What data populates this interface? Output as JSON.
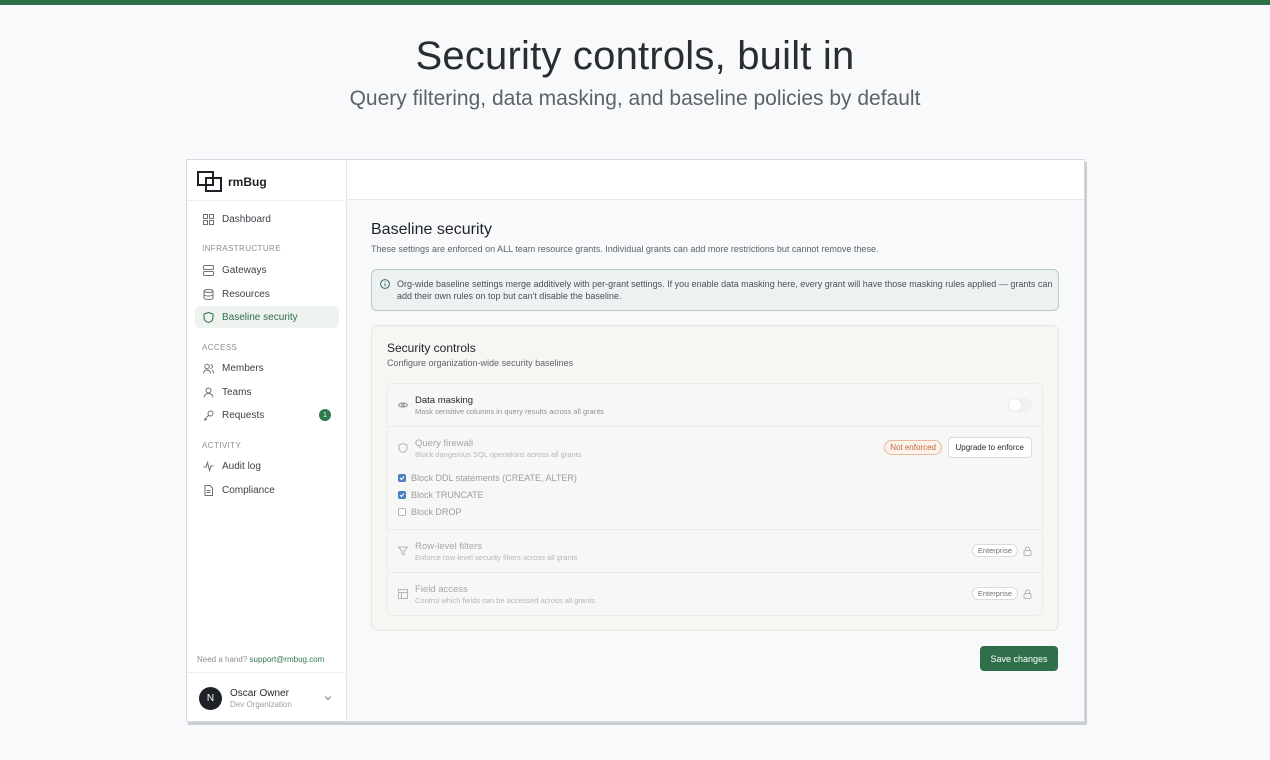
{
  "hero": {
    "title": "Security controls, built in",
    "subtitle": "Query filtering, data masking, and baseline policies by default"
  },
  "brand": {
    "name": "rmBug"
  },
  "sidebar": {
    "items": [
      {
        "label": "Dashboard",
        "icon": "grid-icon"
      },
      {
        "label": "Gateways",
        "icon": "server-icon"
      },
      {
        "label": "Resources",
        "icon": "database-icon"
      },
      {
        "label": "Baseline security",
        "icon": "shield-icon",
        "active": true
      },
      {
        "label": "Members",
        "icon": "users-icon"
      },
      {
        "label": "Teams",
        "icon": "team-icon"
      },
      {
        "label": "Requests",
        "icon": "key-icon",
        "badge": "1"
      },
      {
        "label": "Audit log",
        "icon": "activity-icon"
      },
      {
        "label": "Compliance",
        "icon": "document-icon"
      }
    ],
    "sections": {
      "infrastructure": "INFRASTRUCTURE",
      "access": "ACCESS",
      "activity": "ACTIVITY"
    },
    "help_text": "Need a hand?",
    "help_link": "support@rmbug.com",
    "user": {
      "initial": "N",
      "name": "Oscar Owner",
      "org": "Dev Organization"
    }
  },
  "main": {
    "title": "Baseline security",
    "description": "These settings are enforced on ALL team resource grants. Individual grants can add more restrictions but cannot remove these.",
    "info": "Org-wide baseline settings merge additively with per-grant settings. If you enable data masking here, every grant will have those masking rules applied — grants can add their own rules on top but can't disable the baseline.",
    "card": {
      "title": "Security controls",
      "subtitle": "Configure organization-wide security baselines",
      "data_masking": {
        "title": "Data masking",
        "subtitle": "Mask sensitive columns in query results across all grants",
        "enabled": false
      },
      "query_firewall": {
        "title": "Query firewall",
        "subtitle": "Block dangerous SQL operations across all grants",
        "status": "Not enforced",
        "button": "Upgrade to enforce",
        "options": [
          {
            "label": "Block DDL statements (CREATE, ALTER)",
            "checked": true
          },
          {
            "label": "Block TRUNCATE",
            "checked": true
          },
          {
            "label": "Block DROP",
            "checked": false
          }
        ]
      },
      "row_filters": {
        "title": "Row-level filters",
        "subtitle": "Enforce row-level security filters across all grants",
        "tier": "Enterprise"
      },
      "field_access": {
        "title": "Field access",
        "subtitle": "Control which fields can be accessed across all grants",
        "tier": "Enterprise"
      }
    },
    "save_label": "Save changes"
  },
  "colors": {
    "accent": "#2f6f4a",
    "warning": "#c0683a",
    "checkbox": "#4a7ec2"
  }
}
